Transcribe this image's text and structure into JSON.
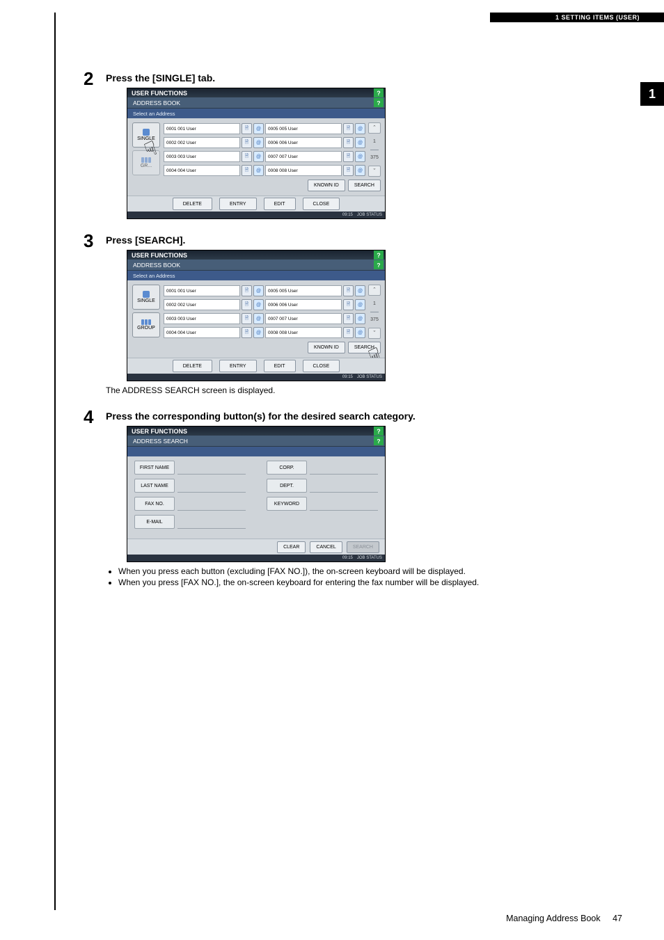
{
  "header": {
    "section": "1 SETTING ITEMS (USER)"
  },
  "side_tab": "1",
  "steps": [
    {
      "num": "2",
      "title": "Press the [SINGLE] tab."
    },
    {
      "num": "3",
      "title": "Press [SEARCH].",
      "after_text": "The ADDRESS SEARCH screen is displayed."
    },
    {
      "num": "4",
      "title": "Press the corresponding button(s) for the desired search category.",
      "bullets": [
        "When you press each button (excluding [FAX NO.]), the on-screen keyboard will be displayed.",
        "When you press [FAX NO.], the on-screen keyboard for entering the fax number will be displayed."
      ]
    }
  ],
  "screenshot_common": {
    "top_title": "USER FUNCTIONS",
    "subtitle": "ADDRESS BOOK",
    "hint": "Select an Address",
    "tabs": {
      "single": "SINGLE",
      "group": "GROUP"
    },
    "entries": [
      {
        "id": "0001",
        "name": "001 User"
      },
      {
        "id": "0002",
        "name": "002 User"
      },
      {
        "id": "0003",
        "name": "003 User"
      },
      {
        "id": "0004",
        "name": "004 User"
      },
      {
        "id": "0005",
        "name": "005 User"
      },
      {
        "id": "0006",
        "name": "006 User"
      },
      {
        "id": "0007",
        "name": "007 User"
      },
      {
        "id": "0008",
        "name": "008 User"
      }
    ],
    "scroll": {
      "page_current": "1",
      "page_total": "375"
    },
    "footer_buttons": {
      "known_id": "KNOWN ID",
      "search": "SEARCH"
    },
    "bottom_buttons": {
      "delete": "DELETE",
      "entry": "ENTRY",
      "edit": "EDIT",
      "close": "CLOSE"
    },
    "status": {
      "time": "09:15",
      "job": "JOB STATUS"
    }
  },
  "screenshot_search": {
    "subtitle": "ADDRESS SEARCH",
    "fields": {
      "first_name": "FIRST NAME",
      "last_name": "LAST NAME",
      "fax_no": "FAX NO.",
      "email": "E-MAIL",
      "corp": "CORP.",
      "dept": "DEPT.",
      "keyword": "KEYWORD"
    },
    "buttons": {
      "clear": "CLEAR",
      "cancel": "CANCEL",
      "search": "SEARCH"
    }
  },
  "footer": {
    "text": "Managing Address Book",
    "page": "47"
  }
}
